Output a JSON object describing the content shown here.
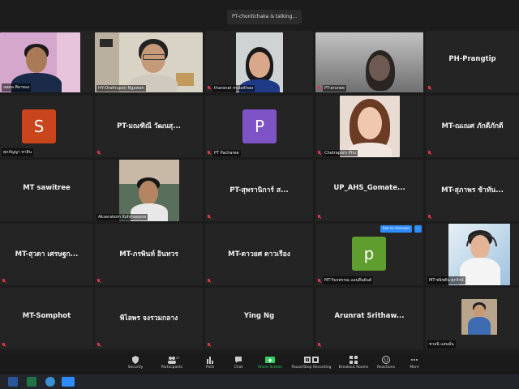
{
  "talking_indicator": "PT-chontichaka is talking...",
  "tiles": [
    {
      "name": "นพดล ศิลาทอง",
      "kind": "video"
    },
    {
      "name": "HY-Orathupon Ngawan",
      "kind": "video"
    },
    {
      "name": "tharanat malaithao",
      "kind": "video"
    },
    {
      "name": "PT-arunee",
      "kind": "video"
    },
    {
      "name": "PH-Prangtip",
      "kind": "name"
    },
    {
      "name": "ศุภกัญญา ทาสิน",
      "kind": "avatar",
      "initial": "S",
      "color": "#c9461d"
    },
    {
      "name": "PT-มณฑิณี วัฒนสุ...",
      "kind": "name"
    },
    {
      "name": "PT Pacharee",
      "kind": "avatar",
      "initial": "P",
      "color": "#7d53c5"
    },
    {
      "name": "Chatraporn Phu",
      "kind": "video"
    },
    {
      "name": "MT-ณเณศ ภักดีภักดี",
      "kind": "name"
    },
    {
      "name": "MT sawitree",
      "kind": "name"
    },
    {
      "name": "Aksarakorn Kuhmaepoe",
      "kind": "video"
    },
    {
      "name": "PT-สุพรานิการ์ ส...",
      "kind": "name"
    },
    {
      "name": "UP_AHS_Gomate...",
      "kind": "name"
    },
    {
      "name": "MT-สุภาพร ช้าทัน...",
      "kind": "name"
    },
    {
      "name": "MT-สุวดา เศรษฐก...",
      "kind": "name"
    },
    {
      "name": "MT-ภรพินท์ อินทวร",
      "kind": "name"
    },
    {
      "name": "MT-ดาวยศ ดาวเรือง",
      "kind": "name"
    },
    {
      "name": "MT-รินรพรรณ แอนยืนยันต์",
      "kind": "avatar",
      "initial": "p",
      "color": "#5f9e2e"
    },
    {
      "name": "MT-ชนิชตัน ศุภรักษ์",
      "kind": "video"
    },
    {
      "name": "MT-Somphot",
      "kind": "name"
    },
    {
      "name": "พิไลพร จงรวมกลาง",
      "kind": "name"
    },
    {
      "name": "Ying Ng",
      "kind": "name"
    },
    {
      "name": "Arunrat Srithaw...",
      "kind": "name"
    },
    {
      "name": "ชวลนิ แสนมั่น",
      "kind": "video"
    }
  ],
  "ask_to_unmute": "Ask to Unmute",
  "more_symbol": "···",
  "toolbar": {
    "security": "Security",
    "participants": "Participants",
    "participants_count": "37",
    "polls": "Polls",
    "chat": "Chat",
    "share_screen": "Share Screen",
    "pause_recording": "Pause/Stop Recording",
    "breakout_rooms": "Breakout Rooms",
    "reactions": "Reactions",
    "more": "More"
  },
  "colors": {
    "background": "#1c1c1c",
    "tile": "#242424",
    "accent_blue": "#2d8cff",
    "share_green": "#2fd05e",
    "mute_red": "#e0364a"
  },
  "taskbar_icons": [
    "word-icon",
    "excel-icon",
    "browser-icon",
    "zoom-icon"
  ]
}
